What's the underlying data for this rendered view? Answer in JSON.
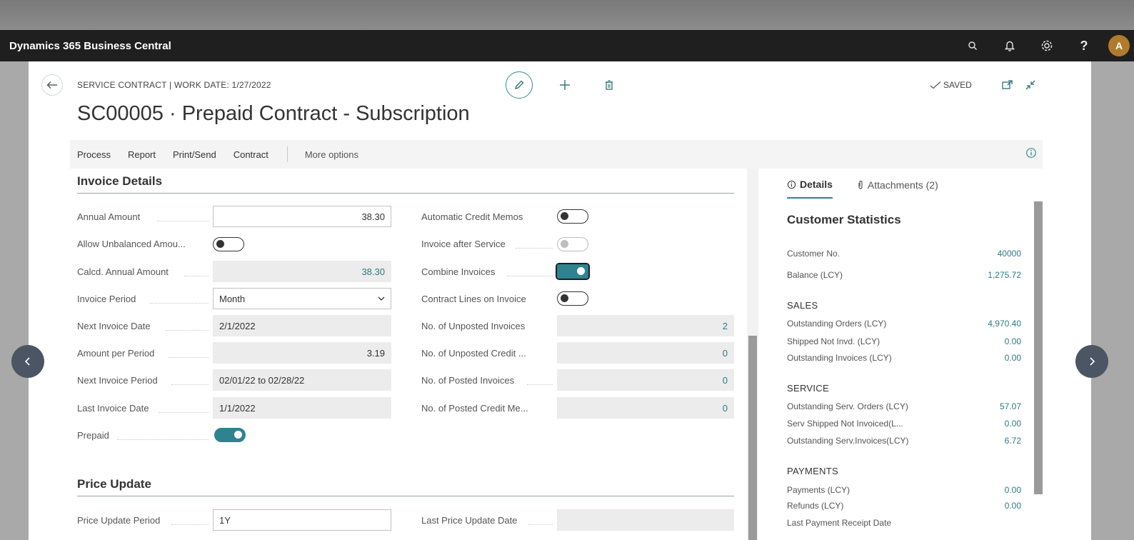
{
  "app_bar": {
    "title": "Dynamics 365 Business Central",
    "avatar_initial": "A",
    "help_label": "?"
  },
  "header": {
    "caption": "SERVICE CONTRACT | WORK DATE: 1/27/2022",
    "title": "SC00005 · Prepaid Contract - Subscription",
    "saved_label": "SAVED"
  },
  "actions": {
    "items": [
      "Process",
      "Report",
      "Print/Send",
      "Contract"
    ],
    "more": "More options"
  },
  "invoice_details": {
    "title": "Invoice Details",
    "left": [
      {
        "label": "Annual Amount",
        "value": "38.30",
        "kind": "input-right"
      },
      {
        "label": "Allow Unbalanced Amou...",
        "value": "",
        "kind": "toggle-off"
      },
      {
        "label": "Calcd. Annual Amount",
        "value": "38.30",
        "kind": "readonly-link"
      },
      {
        "label": "Invoice Period",
        "value": "Month",
        "kind": "select"
      },
      {
        "label": "Next Invoice Date",
        "value": "2/1/2022",
        "kind": "readonly-left"
      },
      {
        "label": "Amount per Period",
        "value": "3.19",
        "kind": "readonly-right"
      },
      {
        "label": "Next Invoice Period",
        "value": "02/01/22 to 02/28/22",
        "kind": "readonly-left"
      },
      {
        "label": "Last Invoice Date",
        "value": "1/1/2022",
        "kind": "readonly-left"
      },
      {
        "label": "Prepaid",
        "value": "",
        "kind": "toggle-on"
      }
    ],
    "right": [
      {
        "label": "Automatic Credit Memos",
        "value": "",
        "kind": "toggle-off"
      },
      {
        "label": "Invoice after Service",
        "value": "",
        "kind": "toggle-disabled"
      },
      {
        "label": "Combine Invoices",
        "value": "",
        "kind": "toggle-on"
      },
      {
        "label": "Contract Lines on Invoice",
        "value": "",
        "kind": "toggle-off"
      },
      {
        "label": "No. of Unposted Invoices",
        "value": "2",
        "kind": "readonly-link"
      },
      {
        "label": "No. of Unposted Credit ...",
        "value": "0",
        "kind": "readonly-link"
      },
      {
        "label": "No. of Posted Invoices",
        "value": "0",
        "kind": "readonly-link"
      },
      {
        "label": "No. of Posted Credit Me...",
        "value": "0",
        "kind": "readonly-link"
      }
    ]
  },
  "price_update": {
    "title": "Price Update",
    "period_label": "Price Update Period",
    "period_value": "1Y",
    "last_date_label": "Last Price Update Date",
    "last_date_value": ""
  },
  "factbox": {
    "tabs": {
      "details": "Details",
      "attachments": "Attachments (2)"
    },
    "title": "Customer Statistics",
    "rows": [
      {
        "label": "Customer No.",
        "value": "40000"
      },
      {
        "label": "Balance (LCY)",
        "value": "1,275.72"
      }
    ],
    "groups": [
      {
        "title": "SALES",
        "rows": [
          {
            "label": "Outstanding Orders (LCY)",
            "value": "4,970.40"
          },
          {
            "label": "Shipped Not Invd. (LCY)",
            "value": "0.00"
          },
          {
            "label": "Outstanding Invoices (LCY)",
            "value": "0.00"
          }
        ]
      },
      {
        "title": "SERVICE",
        "rows": [
          {
            "label": "Outstanding Serv. Orders (LCY)",
            "value": "57.07"
          },
          {
            "label": "Serv Shipped Not Invoiced(L...",
            "value": "0.00"
          },
          {
            "label": "Outstanding Serv.Invoices(LCY)",
            "value": "6.72"
          }
        ]
      },
      {
        "title": "PAYMENTS",
        "rows": [
          {
            "label": "Payments (LCY)",
            "value": "0.00"
          },
          {
            "label": "Refunds (LCY)",
            "value": "0.00"
          },
          {
            "label": "Last Payment Receipt Date",
            "value": ""
          }
        ]
      }
    ]
  }
}
